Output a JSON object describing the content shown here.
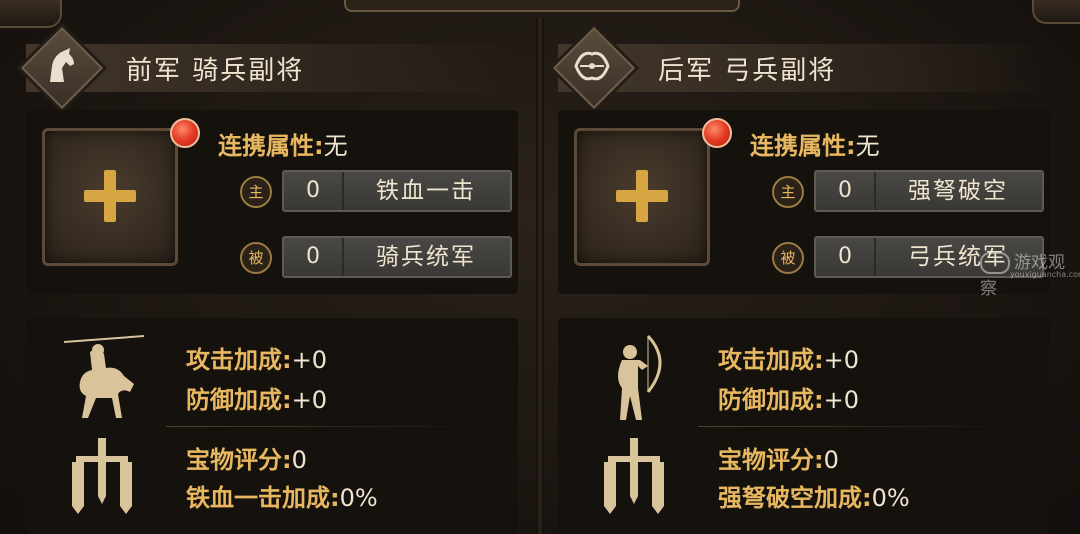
{
  "panels": [
    {
      "title": "前军 骑兵副将",
      "emblem_icon": "horse-head-icon",
      "link_label": "连携属性:",
      "link_value": "无",
      "skills": [
        {
          "tag": "主",
          "level": "0",
          "name": "铁血一击"
        },
        {
          "tag": "被",
          "level": "0",
          "name": "骑兵统军"
        }
      ],
      "unit_icon": "cavalry-rider-icon",
      "stats": {
        "attack_label": "攻击加成:",
        "attack_value": "+0",
        "defense_label": "防御加成:",
        "defense_value": "+0",
        "treasure_label": "宝物评分:",
        "treasure_value": "0",
        "skill_bonus_label": "铁血一击加成:",
        "skill_bonus_value": "0%"
      }
    },
    {
      "title": "后军 弓兵副将",
      "emblem_icon": "bow-icon",
      "link_label": "连携属性:",
      "link_value": "无",
      "skills": [
        {
          "tag": "主",
          "level": "0",
          "name": "强弩破空"
        },
        {
          "tag": "被",
          "level": "0",
          "name": "弓兵统军"
        }
      ],
      "unit_icon": "archer-icon",
      "stats": {
        "attack_label": "攻击加成:",
        "attack_value": "+0",
        "defense_label": "防御加成:",
        "defense_value": "+0",
        "treasure_label": "宝物评分:",
        "treasure_value": "0",
        "skill_bonus_label": "强弩破空加成:",
        "skill_bonus_value": "0%"
      }
    }
  ],
  "colors": {
    "gold": "#e8b860",
    "plus": "#d7a542",
    "notify_red": "#e23a22",
    "text_light": "#efe4cf"
  },
  "watermark": {
    "text": "游戏观察",
    "sub": "youxiguancha.com"
  }
}
